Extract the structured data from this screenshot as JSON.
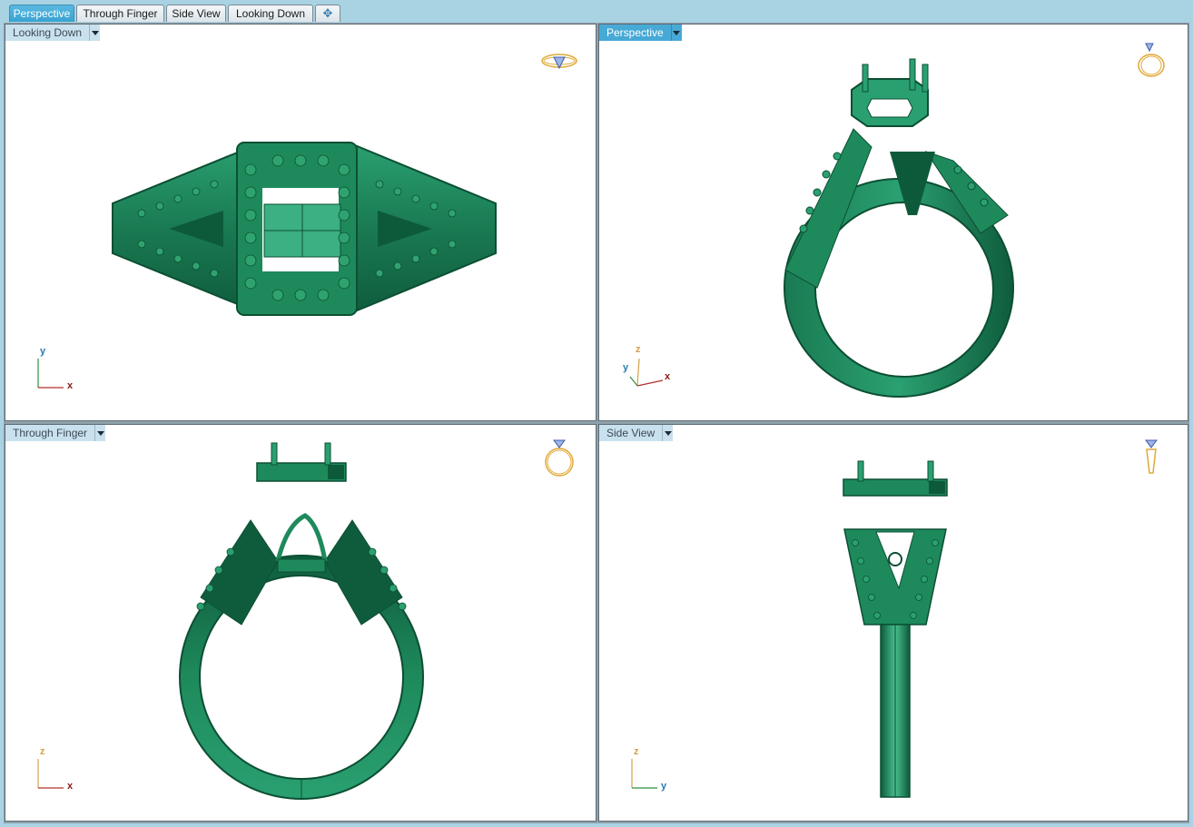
{
  "tabs": [
    {
      "label": "Perspective",
      "active": true
    },
    {
      "label": "Through Finger",
      "active": false
    },
    {
      "label": "Side View",
      "active": false
    },
    {
      "label": "Looking Down",
      "active": false
    }
  ],
  "add_tab_icon": "plus-icon",
  "viewports": {
    "top_left": {
      "label": "Looking Down",
      "axis_h": "x",
      "axis_v": "y",
      "icon": "ring-top-view-icon"
    },
    "top_right": {
      "label": "Perspective",
      "axis_h": "x",
      "axis_v": "z",
      "axis_d": "y",
      "icon": "ring-perspective-icon"
    },
    "bottom_left": {
      "label": "Through Finger",
      "axis_h": "x",
      "axis_v": "z",
      "icon": "ring-front-view-icon"
    },
    "bottom_right": {
      "label": "Side View",
      "axis_h": "y",
      "axis_v": "z",
      "icon": "ring-side-view-icon"
    }
  },
  "colors": {
    "model_green": "#1f8a5e",
    "model_dark": "#0d5a3a",
    "model_light": "#48c08e",
    "tab_active": "#3ea6d4",
    "axis_x": "#b0302a",
    "axis_y": "#2f8f3e",
    "axis_z": "#d4a04a"
  }
}
